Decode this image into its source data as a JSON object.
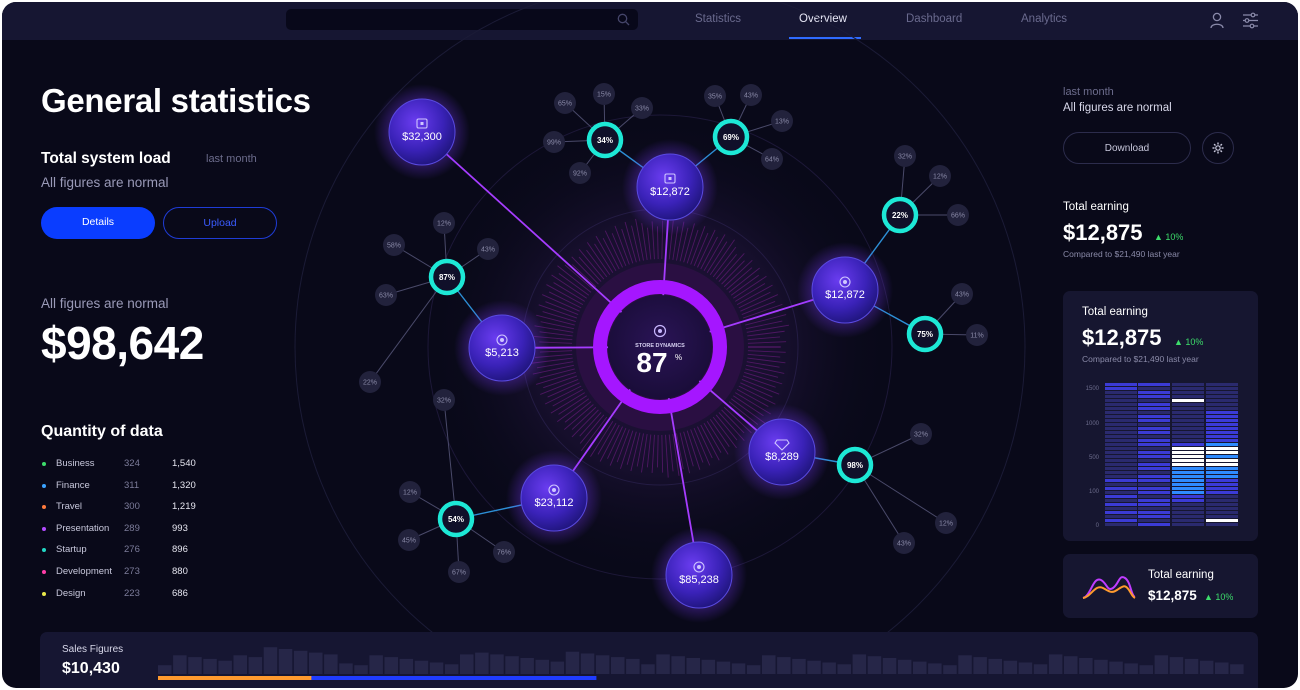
{
  "nav": {
    "tabs": [
      "Statistics",
      "Overview",
      "Dashboard",
      "Analytics"
    ],
    "active": "Overview"
  },
  "icons": {
    "search": "search-icon",
    "user": "user-icon",
    "settings": "sliders-icon",
    "gear": "gear-icon"
  },
  "left": {
    "title": "General statistics",
    "load_title": "Total system load",
    "load_period": "last month",
    "load_status": "All figures are normal",
    "details_label": "Details",
    "upload_label": "Upload",
    "figures_label": "All figures are normal",
    "big_value": "$98,642",
    "quantity_title": "Quantity of data",
    "rows": [
      {
        "name": "Business",
        "a": "324",
        "b": "1,540",
        "color": "#3ddc6b"
      },
      {
        "name": "Finance",
        "a": "311",
        "b": "1,320",
        "color": "#3ba3ff"
      },
      {
        "name": "Travel",
        "a": "300",
        "b": "1,219",
        "color": "#ff7a3d"
      },
      {
        "name": "Presentation",
        "a": "289",
        "b": "993",
        "color": "#b24bff"
      },
      {
        "name": "Startup",
        "a": "276",
        "b": "896",
        "color": "#22d6c4"
      },
      {
        "name": "Development",
        "a": "273",
        "b": "880",
        "color": "#ff3da8"
      },
      {
        "name": "Design",
        "a": "223",
        "b": "686",
        "color": "#e8e84a"
      }
    ]
  },
  "center": {
    "hub_label": "STORE DYNAMICS",
    "hub_value": "87",
    "hub_unit": "%",
    "nodes": [
      "$32,300",
      "$12,872",
      "$12,872",
      "$5,213",
      "$8,289",
      "$23,112",
      "$85,238"
    ],
    "rings": [
      "34%",
      "69%",
      "22%",
      "87%",
      "75%",
      "98%",
      "54%"
    ],
    "leaves": [
      "65%",
      "15%",
      "33%",
      "99%",
      "92%",
      "35%",
      "43%",
      "13%",
      "64%",
      "32%",
      "12%",
      "66%",
      "12%",
      "58%",
      "43%",
      "63%",
      "22%",
      "43%",
      "11%",
      "32%",
      "12%",
      "43%",
      "32%",
      "12%",
      "45%",
      "76%",
      "67%"
    ]
  },
  "right": {
    "period": "last month",
    "status": "All figures are normal",
    "download_label": "Download",
    "earning1": {
      "title": "Total earning",
      "value": "$12,875",
      "change": "10%",
      "compare": "Compared to $21,490 last year"
    },
    "earning2": {
      "title": "Total earning",
      "value": "$12,875",
      "change": "10%",
      "compare": "Compared to $21,490 last year"
    },
    "earning3": {
      "title": "Total earning",
      "value": "$12,875",
      "change": "10%"
    },
    "y_ticks": [
      "1500",
      "1000",
      "500",
      "100",
      "0"
    ],
    "colors": {
      "accent": "#2f6bff",
      "green": "#3ddc6b",
      "bar": "#3b3bd6"
    }
  },
  "sales": {
    "title": "Sales Figures",
    "value": "$10,430",
    "progress_orange": 0.14,
    "progress_blue": 0.4
  }
}
